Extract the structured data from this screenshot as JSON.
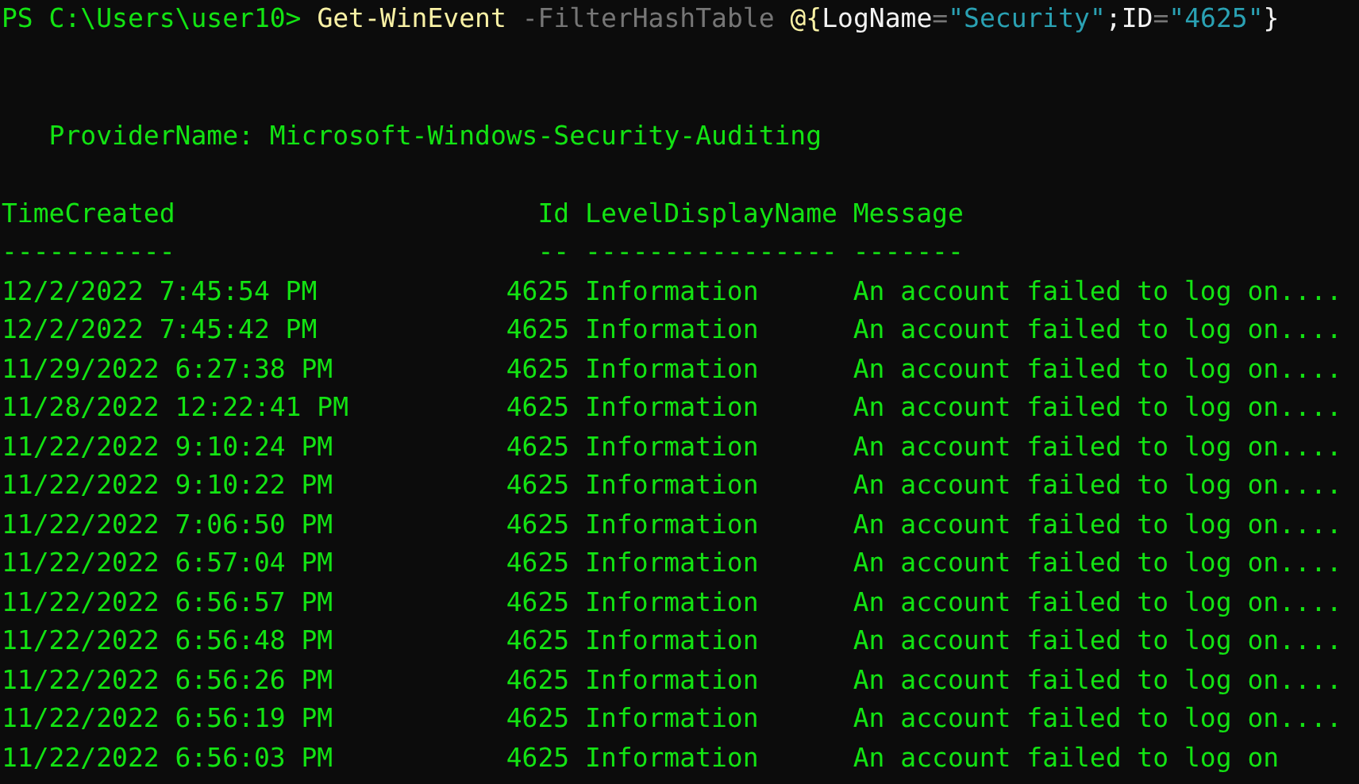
{
  "prompt": {
    "path": "PS C:\\Users\\user10>",
    "tokens": [
      {
        "text": "Get-WinEvent",
        "kind": "command"
      },
      {
        "text": " -FilterHashTable ",
        "kind": "parameter"
      },
      {
        "text": "@{",
        "kind": "operator"
      },
      {
        "text": "LogName",
        "kind": "plain"
      },
      {
        "text": "=",
        "kind": "parameter"
      },
      {
        "text": "\"Security\"",
        "kind": "string"
      },
      {
        "text": ";ID",
        "kind": "plain"
      },
      {
        "text": "=",
        "kind": "parameter"
      },
      {
        "text": "\"4625\"",
        "kind": "string"
      },
      {
        "text": "}",
        "kind": "plain"
      }
    ]
  },
  "provider": {
    "label": "ProviderName:",
    "value": "Microsoft-Windows-Security-Auditing"
  },
  "table": {
    "columns": [
      "TimeCreated",
      "Id",
      "LevelDisplayName",
      "Message"
    ],
    "dividers": [
      "-----------",
      "--",
      "----------------",
      "-------"
    ],
    "rows": [
      [
        "12/2/2022 7:45:54 PM",
        "4625",
        "Information",
        "An account failed to log on...."
      ],
      [
        "12/2/2022 7:45:42 PM",
        "4625",
        "Information",
        "An account failed to log on...."
      ],
      [
        "11/29/2022 6:27:38 PM",
        "4625",
        "Information",
        "An account failed to log on...."
      ],
      [
        "11/28/2022 12:22:41 PM",
        "4625",
        "Information",
        "An account failed to log on...."
      ],
      [
        "11/22/2022 9:10:24 PM",
        "4625",
        "Information",
        "An account failed to log on...."
      ],
      [
        "11/22/2022 9:10:22 PM",
        "4625",
        "Information",
        "An account failed to log on...."
      ],
      [
        "11/22/2022 7:06:50 PM",
        "4625",
        "Information",
        "An account failed to log on...."
      ],
      [
        "11/22/2022 6:57:04 PM",
        "4625",
        "Information",
        "An account failed to log on...."
      ],
      [
        "11/22/2022 6:56:57 PM",
        "4625",
        "Information",
        "An account failed to log on...."
      ],
      [
        "11/22/2022 6:56:48 PM",
        "4625",
        "Information",
        "An account failed to log on...."
      ],
      [
        "11/22/2022 6:56:26 PM",
        "4625",
        "Information",
        "An account failed to log on...."
      ],
      [
        "11/22/2022 6:56:19 PM",
        "4625",
        "Information",
        "An account failed to log on...."
      ],
      [
        "11/22/2022 6:56:03 PM",
        "4625",
        "Information",
        "An account failed to log on"
      ]
    ]
  }
}
